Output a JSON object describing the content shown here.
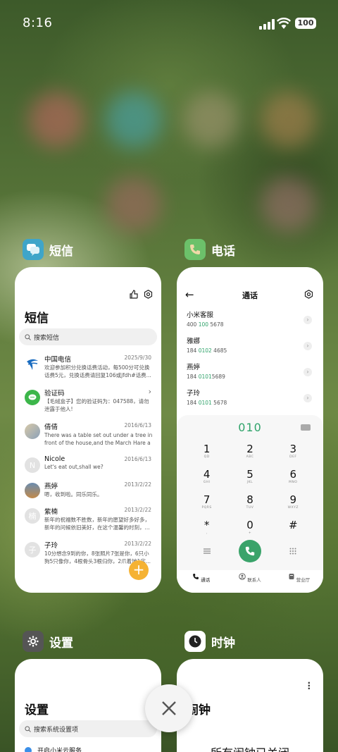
{
  "status_bar": {
    "time": "8:16",
    "battery": "100"
  },
  "apps": {
    "messages": {
      "label": "短信",
      "title": "短信",
      "search_placeholder": "搜索短信",
      "threads": [
        {
          "name": "中国电信",
          "date": "2025/9/30",
          "text": "欢迎参加积分兑换话费活动，每500分可兑换话费5元，兑换话费请回复106或jfdh#话费..."
        },
        {
          "name": "验证码",
          "date": "",
          "text": "【毛绒盒子】您的验证码为：047588，请勿泄露于他人!"
        },
        {
          "name": "倩倩",
          "date": "2016/6/13",
          "text": "There was a table set out under a tree in front of the house,and the March Hare an..."
        },
        {
          "name": "Nicole",
          "date": "2016/6/13",
          "text": "Let's eat out,shall we?"
        },
        {
          "name": "燕婷",
          "date": "2013/2/22",
          "text": "嗯，收到啦。同乐同乐。"
        },
        {
          "name": "紫楠",
          "date": "2013/2/22",
          "text": "新年的祝福数不胜数，新年的愿望好多好多，新年的问候依旧美好，在这个温馨的时刻，..."
        },
        {
          "name": "子玲",
          "date": "2013/2/22",
          "text": "10分想念9到的你，8张照片7张是你，6只小狗5只像你，4根骨头3根归你，2爪着地1字..."
        }
      ],
      "avatar_letters": {
        "ziling": "子",
        "zinan": "楠",
        "nicole": "N"
      }
    },
    "phone": {
      "label": "电话",
      "title": "通话",
      "contacts": [
        {
          "name": "小米客服",
          "pre": "400 ",
          "hi": "100",
          "post": " 5678"
        },
        {
          "name": "雅娜",
          "pre": "184 ",
          "hi": "0102",
          "post": " 4685"
        },
        {
          "name": "燕婷",
          "pre": "184 ",
          "hi": "0101",
          "post": "5689"
        },
        {
          "name": "子玲",
          "pre": "184 ",
          "hi": "0101",
          "post": " 5678"
        }
      ],
      "dial_input": "010",
      "keys": [
        {
          "d": "1",
          "l": "QD"
        },
        {
          "d": "2",
          "l": "ABC"
        },
        {
          "d": "3",
          "l": "DEF"
        },
        {
          "d": "4",
          "l": "GHI"
        },
        {
          "d": "5",
          "l": "JKL"
        },
        {
          "d": "6",
          "l": "MNO"
        },
        {
          "d": "7",
          "l": "PQRS"
        },
        {
          "d": "8",
          "l": "TUV"
        },
        {
          "d": "9",
          "l": "WXYZ"
        },
        {
          "d": "*",
          "l": ","
        },
        {
          "d": "0",
          "l": "+"
        },
        {
          "d": "#",
          "l": ""
        }
      ],
      "tabs": [
        "通话",
        "联系人",
        "营业厅"
      ]
    },
    "settings": {
      "label": "设置",
      "title": "设置",
      "search_placeholder": "搜索系统设置项",
      "first_item": "开启小米云服务"
    },
    "clock": {
      "label": "时钟",
      "title": "闹钟",
      "empty_text": "所有闹钟已关闭"
    }
  },
  "colors": {
    "accent_green": "#2fa36a",
    "fab_orange": "#f5b233",
    "messages_icon": "#3fa5c9",
    "phone_icon": "#5cb85c"
  }
}
